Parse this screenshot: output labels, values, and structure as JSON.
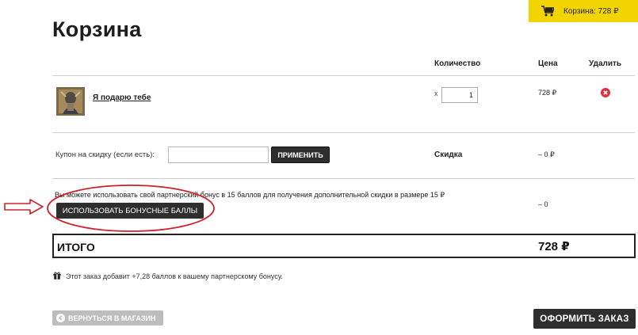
{
  "header": {
    "cart_badge": "Корзина: 728 ₽",
    "title": "Корзина"
  },
  "table": {
    "columns": [
      "Количество",
      "Цена",
      "Удалить"
    ]
  },
  "item": {
    "name": "Я подарю тебе",
    "qty_prefix": "x",
    "quantity": "1",
    "price": "728 ₽"
  },
  "coupon": {
    "label": "Купон на скидку (если есть):",
    "value": "",
    "apply_label": "ПРИМЕНИТЬ",
    "discount_label": "Скидка",
    "discount_value": "– 0 ₽"
  },
  "bonus": {
    "text": "Вы можете использовать свой партнерский бонус в 15 баллов для получения дополнительной скидки в размере 15 ₽",
    "button_label": "ИСПОЛЬЗОВАТЬ БОНУСНЫЕ БАЛЛЫ",
    "value": "– 0"
  },
  "total": {
    "label": "ИТОГО",
    "value": "728 ₽"
  },
  "info": {
    "text": "Этот заказ добавит +7,28 баллов к вашему партнерскому бонусу."
  },
  "footer": {
    "back_label": "ВЕРНУТЬСЯ В МАГАЗИН",
    "checkout_label": "ОФОРМИТЬ ЗАКАЗ"
  },
  "colors": {
    "accent": "#f2d500",
    "dark_button": "#2e2e2e",
    "annotation": "#d0202a",
    "remove": "#d9333f"
  }
}
